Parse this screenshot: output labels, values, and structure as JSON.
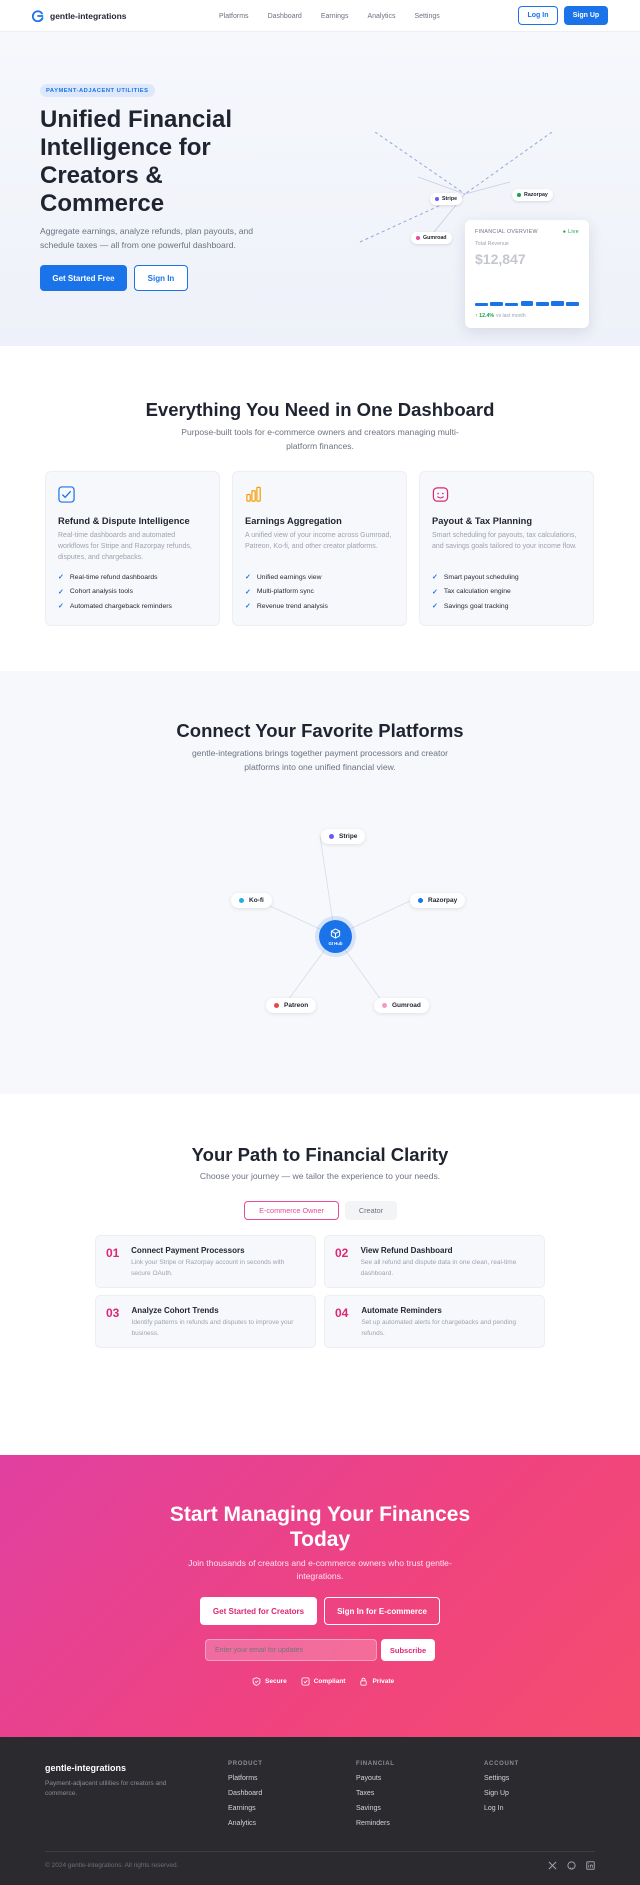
{
  "nav": {
    "brand": "gentle-integrations",
    "links": [
      "Platforms",
      "Dashboard",
      "Earnings",
      "Analytics",
      "Settings"
    ],
    "login": "Log In",
    "signup": "Sign Up"
  },
  "hero": {
    "pill": "PAYMENT-ADJACENT UTILITIES",
    "title": "Unified Financial Intelligence for Creators & Commerce",
    "subtitle": "Aggregate earnings, analyze refunds, plan payouts, and schedule taxes — all from one powerful dashboard.",
    "cta_primary": "Get Started Free",
    "cta_secondary": "Sign In",
    "tags": [
      "Stripe",
      "Razorpay",
      "Gumroad"
    ],
    "overview": {
      "title": "FINANCIAL OVERVIEW",
      "live": "● Live",
      "label": "Total Revenue",
      "value": "$12,847",
      "bar_levels": [
        0.45,
        0.7,
        0.5,
        0.85,
        0.65,
        0.9,
        0.75
      ],
      "trend": "↑ 12.4%",
      "trend_note": "vs last month"
    }
  },
  "features": {
    "title": "Everything You Need in One Dashboard",
    "subtitle": "Purpose-built tools for e-commerce owners and creators managing multi-platform finances.",
    "cards": [
      {
        "icon": "shield-check-icon",
        "title": "Refund & Dispute Intelligence",
        "desc": "Real-time dashboards and automated workflows for Stripe and Razorpay refunds, disputes, and chargebacks.",
        "items": [
          "Real-time refund dashboards",
          "Cohort analysis tools",
          "Automated chargeback reminders"
        ]
      },
      {
        "icon": "bar-chart-icon",
        "title": "Earnings Aggregation",
        "desc": "A unified view of your income across Gumroad, Patreon, Ko-fi, and other creator platforms.",
        "items": [
          "Unified earnings view",
          "Multi-platform sync",
          "Revenue trend analysis"
        ]
      },
      {
        "icon": "piggy-bank-icon",
        "title": "Payout & Tax Planning",
        "desc": "Smart scheduling for payouts, tax calculations, and savings goals tailored to your income flow.",
        "items": [
          "Smart payout scheduling",
          "Tax calculation engine",
          "Savings goal tracking"
        ]
      }
    ]
  },
  "platforms": {
    "title": "Connect Your Favorite Platforms",
    "subtitle": "gentle-integrations brings together payment processors and creator platforms into one unified financial view.",
    "nodes": [
      "Stripe",
      "Ko-fi",
      "Razorpay",
      "Patreon",
      "Gumroad"
    ],
    "hub_label": "GI Hub"
  },
  "path": {
    "title": "Your Path to Financial Clarity",
    "subtitle": "Choose your journey — we tailor the experience to your needs.",
    "tabs": [
      "E-commerce Owner",
      "Creator"
    ],
    "steps": [
      {
        "num": "01",
        "title": "Connect Payment Processors",
        "desc": "Link your Stripe or Razorpay account in seconds with secure OAuth."
      },
      {
        "num": "02",
        "title": "View Refund Dashboard",
        "desc": "See all refund and dispute data in one clean, real-time dashboard."
      },
      {
        "num": "03",
        "title": "Analyze Cohort Trends",
        "desc": "Identify patterns in refunds and disputes to improve your business."
      },
      {
        "num": "04",
        "title": "Automate Reminders",
        "desc": "Set up automated alerts for chargebacks and pending refunds."
      }
    ]
  },
  "cta": {
    "title": "Start Managing Your Finances Today",
    "subtitle": "Join thousands of creators and e-commerce owners who trust gentle-integrations.",
    "btn_creators": "Get Started for Creators",
    "btn_ecommerce": "Sign In for E-commerce",
    "email_placeholder": "Enter your email for updates",
    "subscribe": "Subscribe",
    "trust": [
      "Secure",
      "Compliant",
      "Private"
    ]
  },
  "footer": {
    "brand": "gentle-integrations",
    "desc": "Payment-adjacent utilities for creators and commerce.",
    "columns": [
      {
        "title": "PRODUCT",
        "links": [
          "Platforms",
          "Dashboard",
          "Earnings",
          "Analytics"
        ]
      },
      {
        "title": "FINANCIAL",
        "links": [
          "Payouts",
          "Taxes",
          "Savings",
          "Reminders"
        ]
      },
      {
        "title": "ACCOUNT",
        "links": [
          "Settings",
          "Sign Up",
          "Log In"
        ]
      }
    ],
    "copyright": "© 2024 gentle-integrations. All rights reserved.",
    "social": [
      "x-icon",
      "github-icon",
      "linkedin-icon"
    ]
  },
  "colors": {
    "primary": "#1a73e8",
    "accent": "#ec4899",
    "success": "#16a34a",
    "footer_bg": "#2b2b2f"
  }
}
